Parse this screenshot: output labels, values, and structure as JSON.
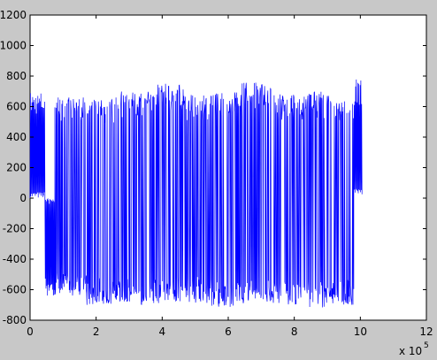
{
  "chart_data": {
    "type": "line",
    "title": "",
    "xlabel": "",
    "ylabel": "",
    "x_exponent_label": "x 10",
    "x_exponent_power": "5",
    "xlim": [
      0,
      12
    ],
    "ylim": [
      -800,
      1200
    ],
    "x_ticks": [
      "0",
      "2",
      "4",
      "6",
      "8",
      "10",
      "12"
    ],
    "y_ticks": [
      "-800",
      "-600",
      "-400",
      "-200",
      "0",
      "200",
      "400",
      "600",
      "800",
      "1000",
      "1200"
    ],
    "series": [
      {
        "color": "#0000ff",
        "segments": [
          {
            "x_start": 0.0,
            "x_end": 0.45,
            "mode": "pos",
            "min": 0,
            "peak": 700
          },
          {
            "x_start": 0.45,
            "x_end": 0.75,
            "mode": "neg",
            "min": -650,
            "peak": 0
          },
          {
            "x_start": 0.75,
            "x_end": 1.7,
            "mode": "mixed",
            "min": -640,
            "peak": 660
          },
          {
            "x_start": 1.7,
            "x_end": 2.6,
            "mode": "mixed",
            "min": -700,
            "peak": 650
          },
          {
            "x_start": 2.6,
            "x_end": 3.6,
            "mode": "mixed",
            "min": -700,
            "peak": 700
          },
          {
            "x_start": 3.6,
            "x_end": 4.7,
            "mode": "mixed",
            "min": -690,
            "peak": 750
          },
          {
            "x_start": 4.7,
            "x_end": 5.5,
            "mode": "mixed",
            "min": -690,
            "peak": 680
          },
          {
            "x_start": 5.5,
            "x_end": 6.4,
            "mode": "mixed",
            "min": -720,
            "peak": 700
          },
          {
            "x_start": 6.4,
            "x_end": 7.3,
            "mode": "mixed",
            "min": -690,
            "peak": 760
          },
          {
            "x_start": 7.3,
            "x_end": 8.3,
            "mode": "mixed",
            "min": -700,
            "peak": 680
          },
          {
            "x_start": 8.3,
            "x_end": 9.1,
            "mode": "mixed",
            "min": -720,
            "peak": 700
          },
          {
            "x_start": 9.1,
            "x_end": 9.8,
            "mode": "mixed",
            "min": -700,
            "peak": 650
          },
          {
            "x_start": 9.8,
            "x_end": 10.05,
            "mode": "pos",
            "min": 20,
            "peak": 780
          }
        ]
      }
    ],
    "grid": false,
    "legend": "none"
  }
}
